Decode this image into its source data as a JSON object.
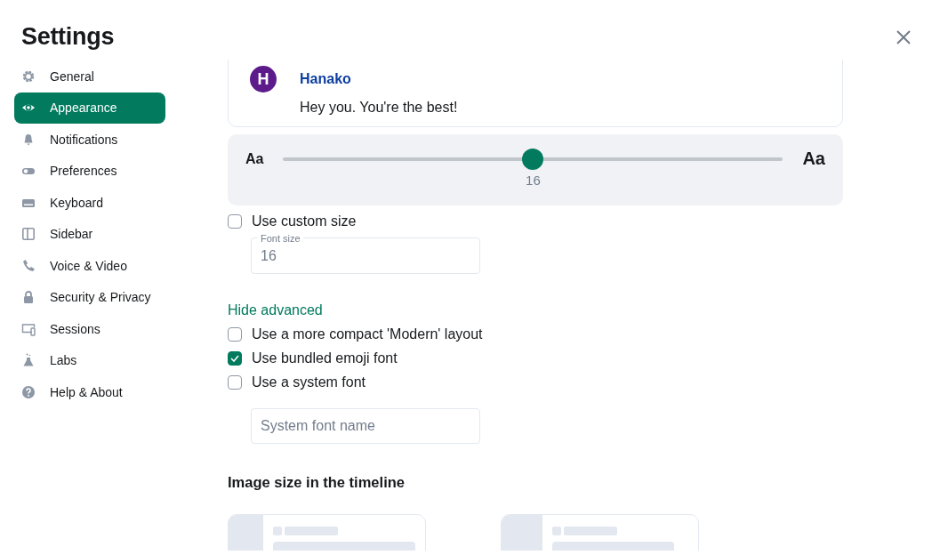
{
  "window": {
    "title": "Settings"
  },
  "sidebar": {
    "items": [
      {
        "label": "General",
        "selected": false
      },
      {
        "label": "Appearance",
        "selected": true
      },
      {
        "label": "Notifications",
        "selected": false
      },
      {
        "label": "Preferences",
        "selected": false
      },
      {
        "label": "Keyboard",
        "selected": false
      },
      {
        "label": "Sidebar",
        "selected": false
      },
      {
        "label": "Voice & Video",
        "selected": false
      },
      {
        "label": "Security & Privacy",
        "selected": false
      },
      {
        "label": "Sessions",
        "selected": false
      },
      {
        "label": "Labs",
        "selected": false
      },
      {
        "label": "Help & About",
        "selected": false
      }
    ]
  },
  "preview": {
    "avatar_letter": "H",
    "sender": "Hanako",
    "message": "Hey you. You're the best!"
  },
  "font_slider": {
    "small_label": "Aa",
    "large_label": "Aa",
    "level": 0.5,
    "reading": "16"
  },
  "custom_size": {
    "label": "Use custom size",
    "checked": false
  },
  "font_size_field": {
    "label": "Font size",
    "value": "16"
  },
  "advanced_link": "Hide advanced",
  "advanced_options": [
    {
      "label": "Use a more compact 'Modern' layout",
      "checked": false
    },
    {
      "label": "Use bundled emoji font",
      "checked": true
    },
    {
      "label": "Use a system font",
      "checked": false
    }
  ],
  "system_font_field": {
    "placeholder": "System font name"
  },
  "image_size": {
    "heading": "Image size in the timeline"
  }
}
